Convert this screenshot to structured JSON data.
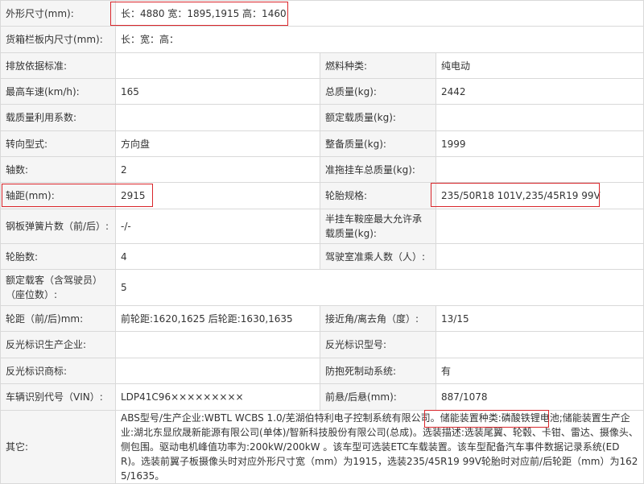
{
  "accent_color": "#d9262b",
  "rows": {
    "dims": {
      "label": "外形尺寸(mm):",
      "value": "长：4880 宽：1895,1915 高：1460"
    },
    "cargo": {
      "label": "货箱栏板内尺寸(mm):",
      "value": "长：宽：高："
    },
    "emission": {
      "label": "排放依据标准:",
      "value": "",
      "label2": "燃料种类:",
      "value2": "纯电动"
    },
    "speed": {
      "label": "最高车速(km/h):",
      "value": "165",
      "label2": "总质量(kg):",
      "value2": "2442"
    },
    "load_util": {
      "label": "载质量利用系数:",
      "value": "",
      "label2": "额定载质量(kg):",
      "value2": ""
    },
    "steering": {
      "label": "转向型式:",
      "value": "方向盘",
      "label2": "整备质量(kg):",
      "value2": "1999"
    },
    "axles": {
      "label": "轴数:",
      "value": "2",
      "label2": "准拖挂车总质量(kg):",
      "value2": ""
    },
    "wheelbase": {
      "label": "轴距(mm):",
      "value": "2915",
      "label2": "轮胎规格:",
      "value2": "235/50R18 101V,235/45R19 99V"
    },
    "springs": {
      "label": "钢板弹簧片数（前/后）:",
      "value": "-/-",
      "label2": "半挂车鞍座最大允许承载质量(kg):",
      "value2": ""
    },
    "tires": {
      "label": "轮胎数:",
      "value": "4",
      "label2": "驾驶室准乘人数（人）:",
      "value2": ""
    },
    "seats": {
      "label": "额定载客（含驾驶员）（座位数）:",
      "value": "5"
    },
    "track": {
      "label": "轮距（前/后)mm:",
      "value": "前轮距:1620,1625 后轮距:1630,1635",
      "label2": "接近角/离去角（度）:",
      "value2": "13/15"
    },
    "reflector_maker": {
      "label": "反光标识生产企业:",
      "value": "",
      "label2": "反光标识型号:",
      "value2": ""
    },
    "reflector_brand": {
      "label": "反光标识商标:",
      "value": "",
      "label2": "防抱死制动系统:",
      "value2": "有"
    },
    "vin": {
      "label": "车辆识别代号（VIN）:",
      "value": "LDP41C96×××××××××",
      "label2": "前悬/后悬(mm):",
      "value2": "887/1078"
    },
    "other": {
      "label": "其它:",
      "value": "ABS型号/生产企业:WBTL WCBS 1.0/芜湖伯特利电子控制系统有限公司。储能装置种类:磷酸铁锂电池;储能装置生产企业:湖北东显欣晟新能源有限公司(单体)/智新科技股份有限公司(总成)。选装描述:选装尾翼、轮毂、卡钳、雷达、摄像头、侧包围。驱动电机峰值功率为:200kW/200kW 。该车型可选装ETC车载装置。该车型配备汽车事件数据记录系统(EDR)。选装前翼子板摄像头时对应外形尺寸宽（mm）为1915，选装235/45R19 99V轮胎时对应前/后轮距（mm）为1625/1635。"
    }
  }
}
